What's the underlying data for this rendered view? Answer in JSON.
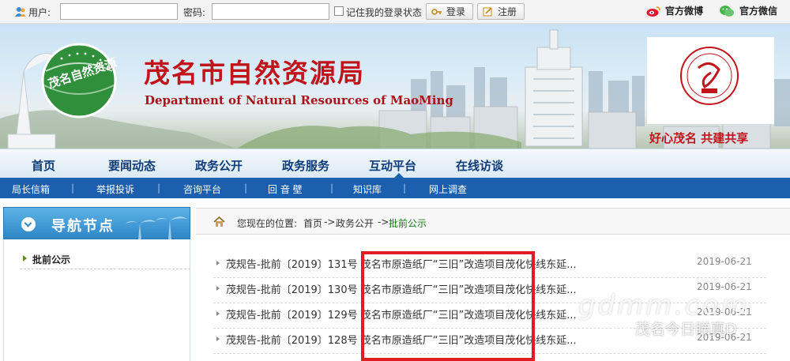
{
  "login": {
    "user_label": "用户:",
    "password_label": "密码:",
    "remember_label": "记住我的登录状态",
    "login_button": "登录",
    "register_button": "注册"
  },
  "social": {
    "weibo": "官方微博",
    "weixin": "官方微信"
  },
  "banner": {
    "title": "茂名市自然资源局",
    "title_en": "Department of Natural Resources of MaoMing",
    "logo_text": "茂名自然资源",
    "slogan": "好心茂名 共建共享"
  },
  "main_nav": [
    "首页",
    "要闻动态",
    "政务公开",
    "政务服务",
    "互动平台",
    "在线访谈"
  ],
  "sub_nav": [
    "局长信箱",
    "举报投诉",
    "咨询平台",
    "回 音 壁",
    "知识库",
    "网上调查"
  ],
  "sidebar": {
    "title": "导航节点",
    "items": [
      {
        "label": "批前公示"
      }
    ]
  },
  "breadcrumb": {
    "prefix": "您现在的位置:",
    "home": "首页",
    "sep1": "->",
    "section": "政务公开",
    "sep2": "->",
    "current": "批前公示"
  },
  "list": [
    {
      "title": "茂规告-批前〔2019〕131号 茂名市原造纸厂“三旧”改造项目茂化快线东延...",
      "date": "2019-06-21"
    },
    {
      "title": "茂规告-批前〔2019〕130号 茂名市原造纸厂“三旧”改造项目茂化快线东延...",
      "date": "2019-06-21"
    },
    {
      "title": "茂规告-批前〔2019〕129号 茂名市原造纸厂“三旧”改造项目茂化快线东延...",
      "date": "2019-06-21"
    },
    {
      "title": "茂规告-批前〔2019〕128号 茂名市原造纸厂“三旧”改造项目茂化快线东延...",
      "date": "2019-06-21"
    }
  ],
  "watermark": {
    "site": "gdmm.com",
    "account": "茂名今日睇真D"
  },
  "colors": {
    "title_red": "#c2151b",
    "nav_blue": "#1b5fae",
    "highlight_box": "#e21d22"
  }
}
